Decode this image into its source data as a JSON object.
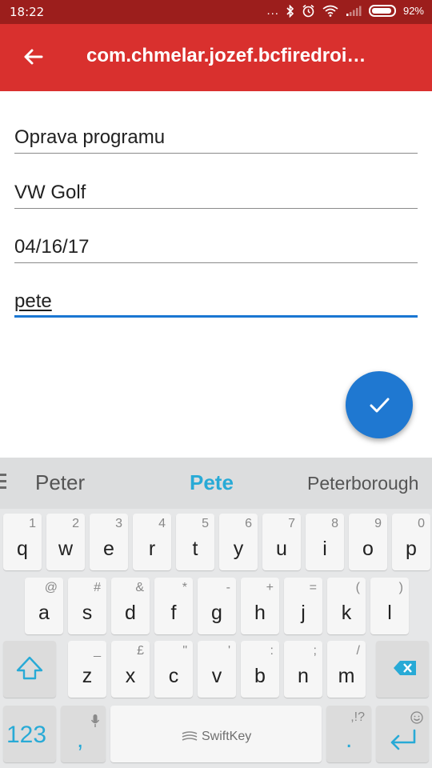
{
  "status_bar": {
    "time": "18:22",
    "dots": "...",
    "battery_pct": "92%",
    "battery_level": 0.92,
    "icons": [
      "bluetooth-icon",
      "alarm-icon",
      "wifi-icon",
      "signal-icon",
      "battery-icon"
    ]
  },
  "app_bar": {
    "title": "com.chmelar.jozef.bcfiredroi…",
    "back_icon": "arrow-left-icon",
    "color": "#d9302e"
  },
  "form": {
    "field1": "Oprava programu",
    "field2": "VW Golf",
    "field3": "04/16/17",
    "field4": "pete",
    "accent": "#1976d2"
  },
  "fab": {
    "icon": "checkmark-icon",
    "color": "#1f78d1"
  },
  "keyboard": {
    "suggestions": [
      "Peter",
      "Pete",
      "Peterborough"
    ],
    "suggest_accent": "#28aad6",
    "row1": [
      {
        "k": "q",
        "s": "1"
      },
      {
        "k": "w",
        "s": "2"
      },
      {
        "k": "e",
        "s": "3"
      },
      {
        "k": "r",
        "s": "4"
      },
      {
        "k": "t",
        "s": "5"
      },
      {
        "k": "y",
        "s": "6"
      },
      {
        "k": "u",
        "s": "7"
      },
      {
        "k": "i",
        "s": "8"
      },
      {
        "k": "o",
        "s": "9"
      },
      {
        "k": "p",
        "s": "0"
      }
    ],
    "row2": [
      {
        "k": "a",
        "s": "@"
      },
      {
        "k": "s",
        "s": "#"
      },
      {
        "k": "d",
        "s": "&"
      },
      {
        "k": "f",
        "s": "*"
      },
      {
        "k": "g",
        "s": "-"
      },
      {
        "k": "h",
        "s": "+"
      },
      {
        "k": "j",
        "s": "="
      },
      {
        "k": "k",
        "s": "("
      },
      {
        "k": "l",
        "s": ")"
      }
    ],
    "row3": [
      {
        "k": "z",
        "s": "_"
      },
      {
        "k": "x",
        "s": "£"
      },
      {
        "k": "c",
        "s": "\""
      },
      {
        "k": "v",
        "s": "'"
      },
      {
        "k": "b",
        "s": ":"
      },
      {
        "k": "n",
        "s": ";"
      },
      {
        "k": "m",
        "s": "/"
      }
    ],
    "numbers_label": "123",
    "comma": ",",
    "period": ".",
    "punct_label": ",!?",
    "space_label": "SwiftKey"
  }
}
